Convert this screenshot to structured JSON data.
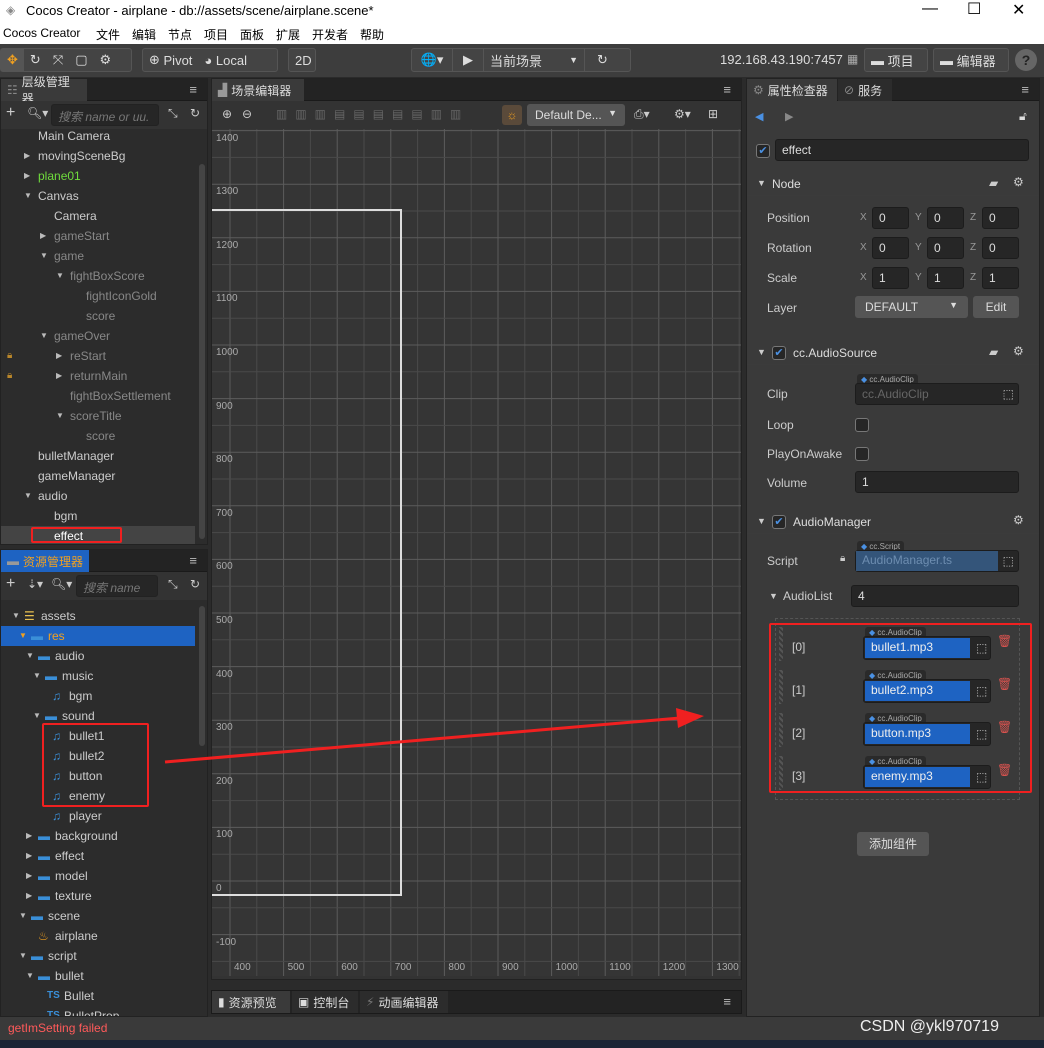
{
  "window": {
    "title": "Cocos Creator - airplane - db://assets/scene/airplane.scene*",
    "controls": [
      "minimize",
      "maximize",
      "close"
    ]
  },
  "menu": [
    "Cocos Creator",
    "文件",
    "编辑",
    "节点",
    "项目",
    "面板",
    "扩展",
    "开发者",
    "帮助"
  ],
  "toolbar": {
    "pivot": "Pivot",
    "local": "Local",
    "mode2d": "2D",
    "scene_select": "当前场景",
    "ip": "192.168.43.190:7457",
    "project": "项目",
    "editor": "编辑器",
    "help": "?"
  },
  "hierarchy": {
    "title": "层级管理器",
    "search_placeholder": "搜索 name or uu.",
    "items": [
      {
        "label": "Main Camera",
        "level": 1,
        "arrow": "",
        "color": "#cccccc"
      },
      {
        "label": "movingSceneBg",
        "level": 1,
        "arrow": "closed",
        "color": "#cccccc"
      },
      {
        "label": "plane01",
        "level": 1,
        "arrow": "closed",
        "color": "#6fdc3c"
      },
      {
        "label": "Canvas",
        "level": 1,
        "arrow": "open",
        "color": "#cccccc"
      },
      {
        "label": "Camera",
        "level": 2,
        "arrow": "",
        "color": "#cccccc"
      },
      {
        "label": "gameStart",
        "level": 2,
        "arrow": "closed",
        "color": "#888888"
      },
      {
        "label": "game",
        "level": 2,
        "arrow": "open",
        "color": "#888888"
      },
      {
        "label": "fightBoxScore",
        "level": 3,
        "arrow": "open",
        "color": "#888888"
      },
      {
        "label": "fightIconGold",
        "level": 4,
        "arrow": "",
        "color": "#888888"
      },
      {
        "label": "score",
        "level": 4,
        "arrow": "",
        "color": "#888888"
      },
      {
        "label": "gameOver",
        "level": 2,
        "arrow": "open",
        "color": "#888888"
      },
      {
        "label": "reStart",
        "level": 3,
        "arrow": "closed",
        "color": "#888888",
        "locked": true
      },
      {
        "label": "returnMain",
        "level": 3,
        "arrow": "closed",
        "color": "#888888",
        "locked": true
      },
      {
        "label": "fightBoxSettlement",
        "level": 3,
        "arrow": "",
        "color": "#888888"
      },
      {
        "label": "scoreTitle",
        "level": 3,
        "arrow": "open",
        "color": "#888888"
      },
      {
        "label": "score",
        "level": 4,
        "arrow": "",
        "color": "#888888"
      },
      {
        "label": "bulletManager",
        "level": 1,
        "arrow": "",
        "color": "#cccccc"
      },
      {
        "label": "gameManager",
        "level": 1,
        "arrow": "",
        "color": "#cccccc"
      },
      {
        "label": "audio",
        "level": 1,
        "arrow": "open",
        "color": "#cccccc"
      },
      {
        "label": "bgm",
        "level": 2,
        "arrow": "",
        "color": "#cccccc"
      },
      {
        "label": "effect",
        "level": 2,
        "arrow": "",
        "color": "#ffffff",
        "selected": true
      }
    ]
  },
  "assets": {
    "title": "资源管理器",
    "search_placeholder": "搜索 name",
    "items": [
      {
        "label": "assets",
        "level": 0,
        "arrow": "open",
        "icon": "database"
      },
      {
        "label": "res",
        "level": 1,
        "arrow": "open",
        "icon": "folder",
        "selected": true
      },
      {
        "label": "audio",
        "level": 2,
        "arrow": "open",
        "icon": "folder"
      },
      {
        "label": "music",
        "level": 3,
        "arrow": "open",
        "icon": "folder"
      },
      {
        "label": "bgm",
        "level": 4,
        "arrow": "",
        "icon": "music"
      },
      {
        "label": "sound",
        "level": 3,
        "arrow": "open",
        "icon": "folder"
      },
      {
        "label": "bullet1",
        "level": 4,
        "arrow": "",
        "icon": "music"
      },
      {
        "label": "bullet2",
        "level": 4,
        "arrow": "",
        "icon": "music"
      },
      {
        "label": "button",
        "level": 4,
        "arrow": "",
        "icon": "music"
      },
      {
        "label": "enemy",
        "level": 4,
        "arrow": "",
        "icon": "music"
      },
      {
        "label": "player",
        "level": 4,
        "arrow": "",
        "icon": "music"
      },
      {
        "label": "background",
        "level": 2,
        "arrow": "closed",
        "icon": "folder"
      },
      {
        "label": "effect",
        "level": 2,
        "arrow": "closed",
        "icon": "folder"
      },
      {
        "label": "model",
        "level": 2,
        "arrow": "closed",
        "icon": "folder"
      },
      {
        "label": "texture",
        "level": 2,
        "arrow": "closed",
        "icon": "folder"
      },
      {
        "label": "scene",
        "level": 1,
        "arrow": "open",
        "icon": "folder"
      },
      {
        "label": "airplane",
        "level": 2,
        "arrow": "",
        "icon": "scene"
      },
      {
        "label": "script",
        "level": 1,
        "arrow": "open",
        "icon": "folder"
      },
      {
        "label": "bullet",
        "level": 2,
        "arrow": "open",
        "icon": "folder"
      },
      {
        "label": "Bullet",
        "level": 3,
        "arrow": "",
        "icon": "ts"
      },
      {
        "label": "BulletProp",
        "level": 3,
        "arrow": "",
        "icon": "ts"
      }
    ]
  },
  "scene": {
    "title": "场景编辑器",
    "camera_select": "Default De...",
    "ruler_x": [
      400,
      500,
      600,
      700,
      800,
      900,
      1000,
      1100,
      1200,
      1300
    ],
    "ruler_y": [
      1400,
      1300,
      1200,
      1100,
      1000,
      900,
      800,
      700,
      600,
      500,
      400,
      300,
      200,
      100,
      0,
      -100
    ]
  },
  "bottom_tabs": [
    "资源预览",
    "控制台",
    "动画编辑器"
  ],
  "inspector": {
    "tabs": [
      "属性检查器",
      "服务"
    ],
    "node_name": "effect",
    "node_active": true,
    "node": {
      "title": "Node",
      "position": {
        "x": "0",
        "y": "0",
        "z": "0"
      },
      "rotation": {
        "x": "0",
        "y": "0",
        "z": "0"
      },
      "scale": {
        "x": "1",
        "y": "1",
        "z": "1"
      },
      "layer": "DEFAULT",
      "edit": "Edit",
      "labels": {
        "position": "Position",
        "rotation": "Rotation",
        "scale": "Scale",
        "layer": "Layer"
      }
    },
    "audio_source": {
      "title": "cc.AudioSource",
      "enabled": true,
      "clip_label": "Clip",
      "clip_type": "cc.AudioClip",
      "clip_placeholder": "cc.AudioClip",
      "loop_label": "Loop",
      "loop": false,
      "play_label": "PlayOnAwake",
      "play_on_awake": false,
      "volume_label": "Volume",
      "volume": "1"
    },
    "audio_manager": {
      "title": "AudioManager",
      "enabled": true,
      "script_label": "Script",
      "script_type": "cc.Script",
      "script": "AudioManager.ts",
      "list_label": "AudioList",
      "list_count": "4",
      "list": [
        {
          "index": "[0]",
          "type": "cc.AudioClip",
          "value": "bullet1.mp3"
        },
        {
          "index": "[1]",
          "type": "cc.AudioClip",
          "value": "bullet2.mp3"
        },
        {
          "index": "[2]",
          "type": "cc.AudioClip",
          "value": "button.mp3"
        },
        {
          "index": "[3]",
          "type": "cc.AudioClip",
          "value": "enemy.mp3"
        }
      ]
    },
    "add_component": "添加组件"
  },
  "status": {
    "message": "getImSetting failed",
    "message_color": "#ff5a5a",
    "watermark": "CSDN @ykl970719"
  },
  "colors": {
    "accent": "#1e63c2",
    "highlight": "#f02020",
    "selected_text": "#f0a020"
  }
}
